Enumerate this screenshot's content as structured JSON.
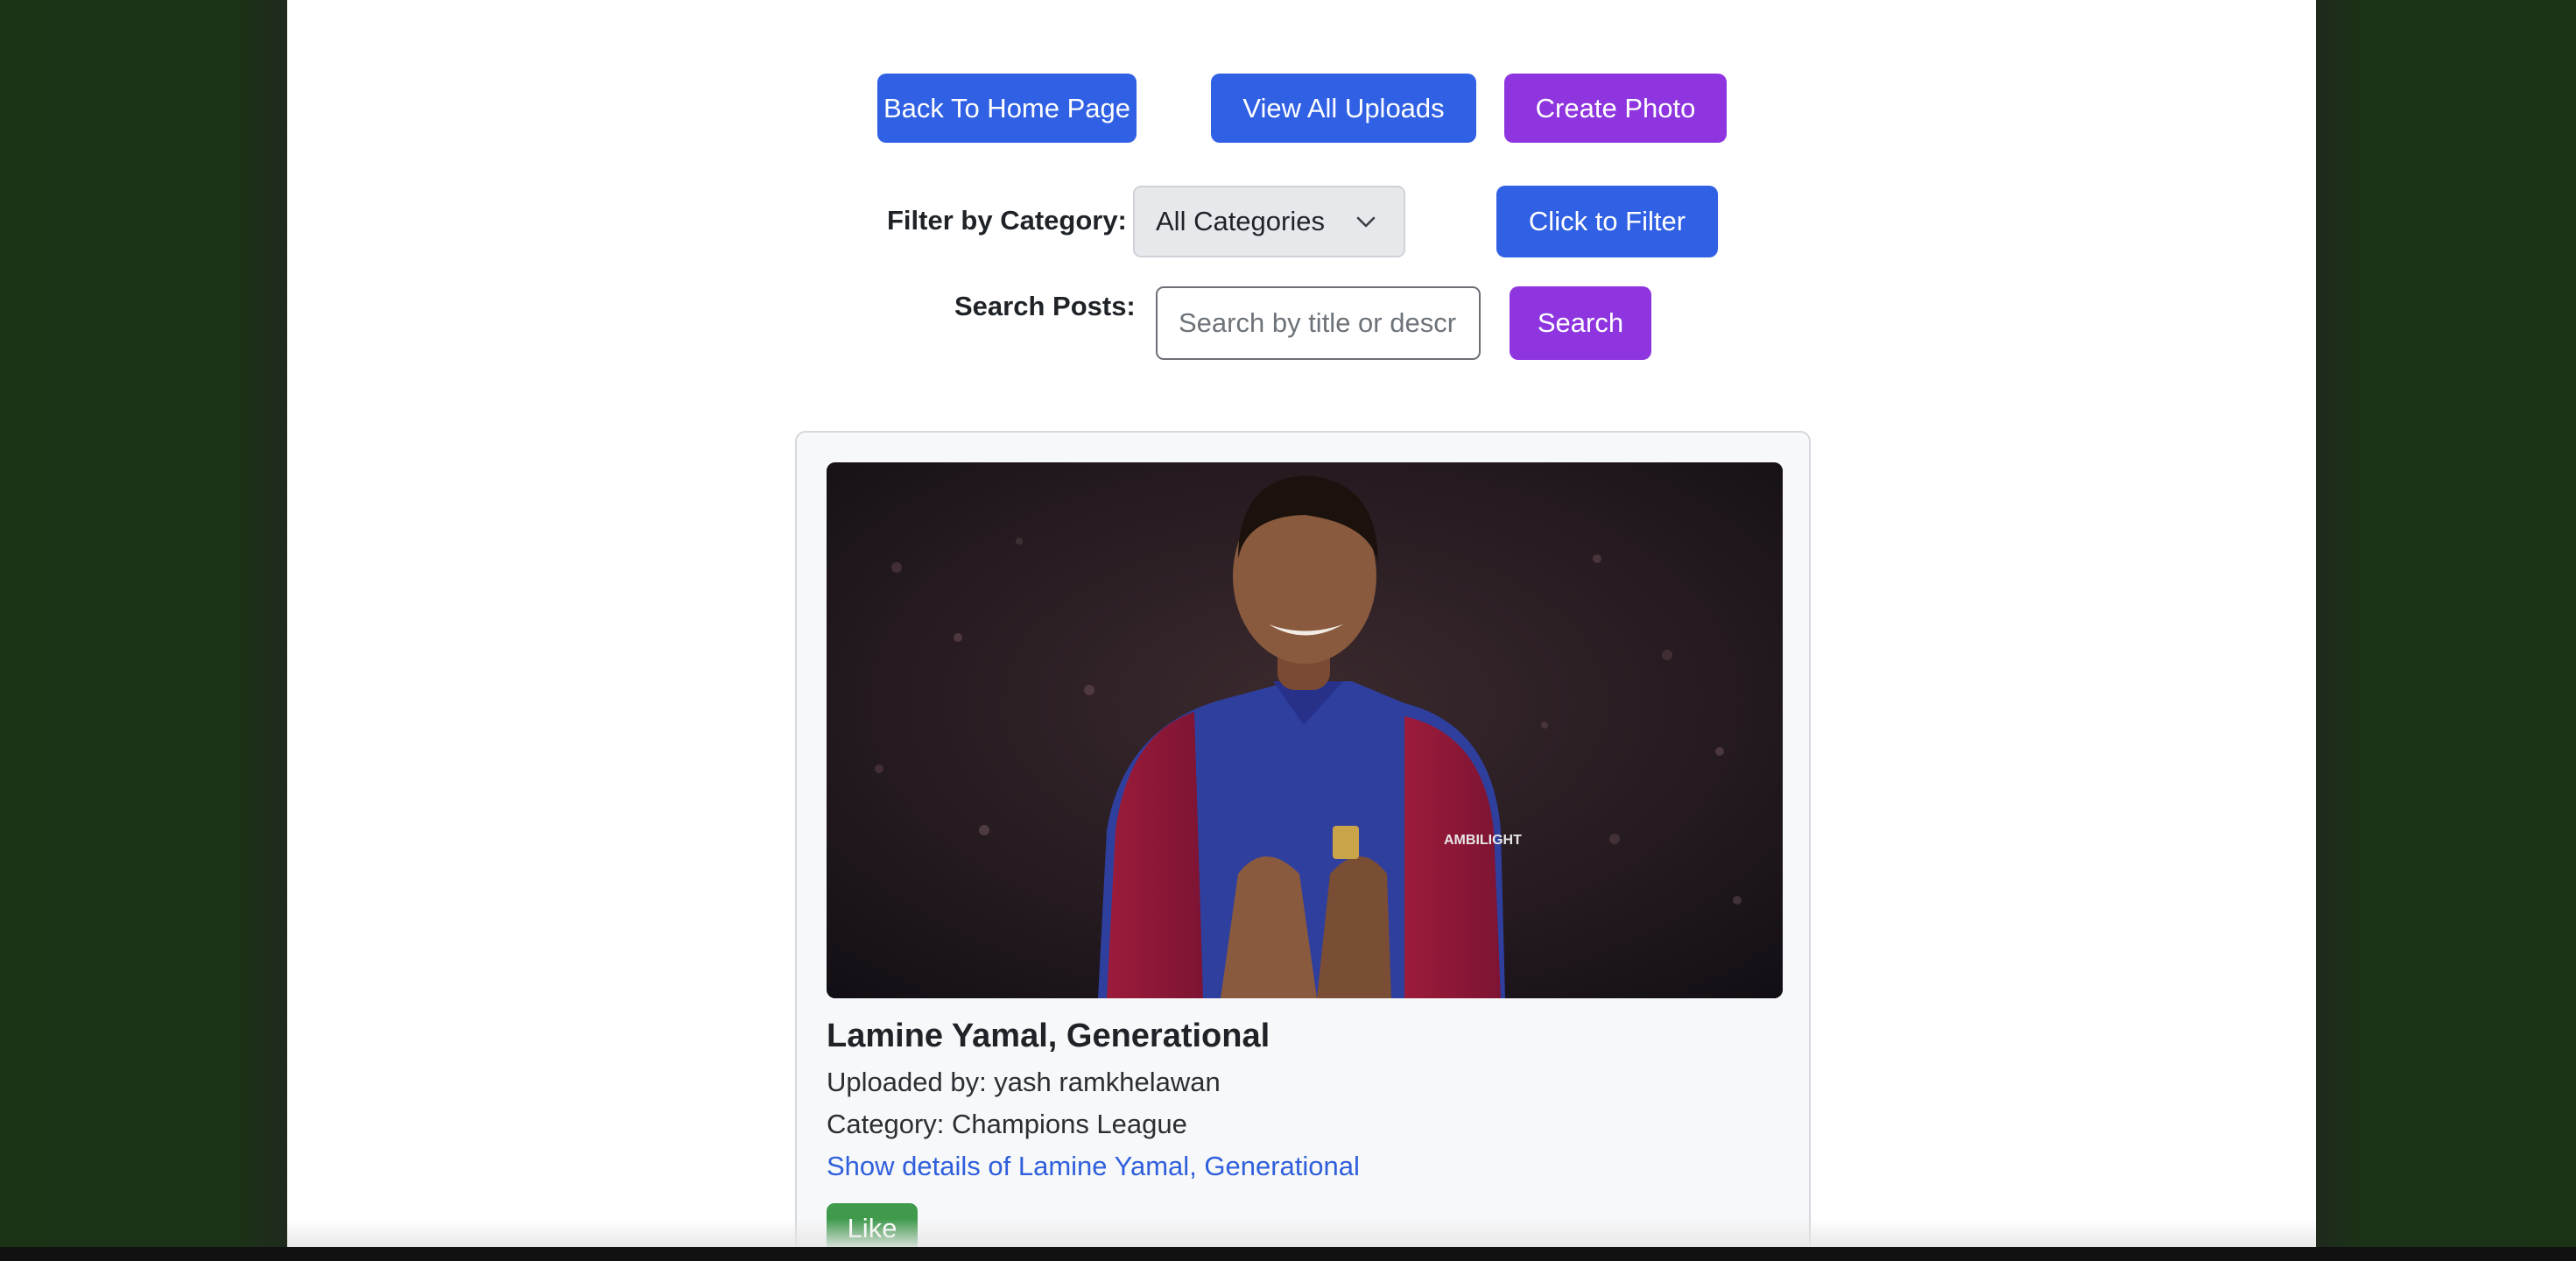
{
  "nav": {
    "home_label": "Back To Home Page",
    "uploads_label": "View All Uploads",
    "create_label": "Create Photo"
  },
  "filter": {
    "label": "Filter by Category:",
    "selected": "All Categories",
    "button_label": "Click to Filter"
  },
  "search": {
    "label": "Search Posts:",
    "placeholder": "Search by title or description",
    "button_label": "Search"
  },
  "post": {
    "title": "Lamine Yamal, Generational",
    "uploaded_by": "Uploaded by: yash ramkhelawan",
    "category": "Category: Champions League",
    "details_link": "Show details of Lamine Yamal, Generational",
    "like_label": "Like",
    "jersey_sponsor": "AMBILIGHT"
  },
  "colors": {
    "blue": "#3060e3",
    "purple": "#8e35e0",
    "green": "#3f9a4c",
    "background": "#1a3315"
  }
}
